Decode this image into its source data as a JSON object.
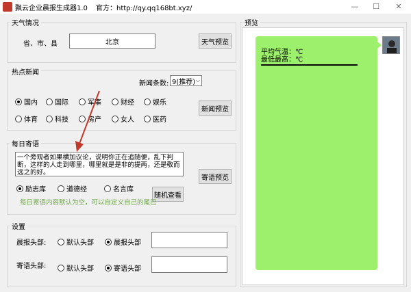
{
  "window": {
    "title": "飘云企业晨报生成器1.0",
    "official": "官方：http://qy.qq168bt.xyz/",
    "minimize": "—",
    "maximize": "☐",
    "close": "✕"
  },
  "weather": {
    "legend": "天气情况",
    "region_label": "省、市、县",
    "region_value": "北京",
    "preview_button": "天气预览"
  },
  "news": {
    "legend": "热点新闻",
    "count_label": "新闻条数:",
    "count_value": "9(推荐)",
    "categories": [
      {
        "label": "国内",
        "checked": true
      },
      {
        "label": "国际",
        "checked": false
      },
      {
        "label": "军事",
        "checked": false
      },
      {
        "label": "财经",
        "checked": false
      },
      {
        "label": "娱乐",
        "checked": false
      },
      {
        "label": "体育",
        "checked": false
      },
      {
        "label": "科技",
        "checked": false
      },
      {
        "label": "房产",
        "checked": false
      },
      {
        "label": "女人",
        "checked": false
      },
      {
        "label": "医药",
        "checked": false
      }
    ],
    "preview_button": "新闻预览"
  },
  "daily": {
    "legend": "每日寄语",
    "text": "一个旁观者如果横加议论，说明你正在追随便，乱下判断，这样的人走到哪里，哪里就是是非的提两，还是敬而远之的好。",
    "preview_button": "寄语预览",
    "sources": [
      {
        "label": "励志库",
        "checked": true
      },
      {
        "label": "道德经",
        "checked": false
      },
      {
        "label": "名言库",
        "checked": false
      }
    ],
    "random_button": "随机查看",
    "hint": "每日寄语内容默认为空，可以自定义自己的尾巴"
  },
  "settings": {
    "legend": "设置",
    "rows": [
      {
        "label": "晨报头部:",
        "options": [
          {
            "label": "默认头部",
            "checked": false
          },
          {
            "label": "晨报头部",
            "checked": true
          }
        ]
      },
      {
        "label": "寄语头部:",
        "options": [
          {
            "label": "默认头部",
            "checked": false
          },
          {
            "label": "寄语头部",
            "checked": true
          }
        ]
      }
    ]
  },
  "preview": {
    "legend": "预览",
    "line1": "平均气温：℃",
    "line2": "最低最高：℃"
  },
  "colors": {
    "bubble": "#9df06c",
    "annotation_arrow": "#c0392b",
    "hint_text": "#6fa84a"
  }
}
